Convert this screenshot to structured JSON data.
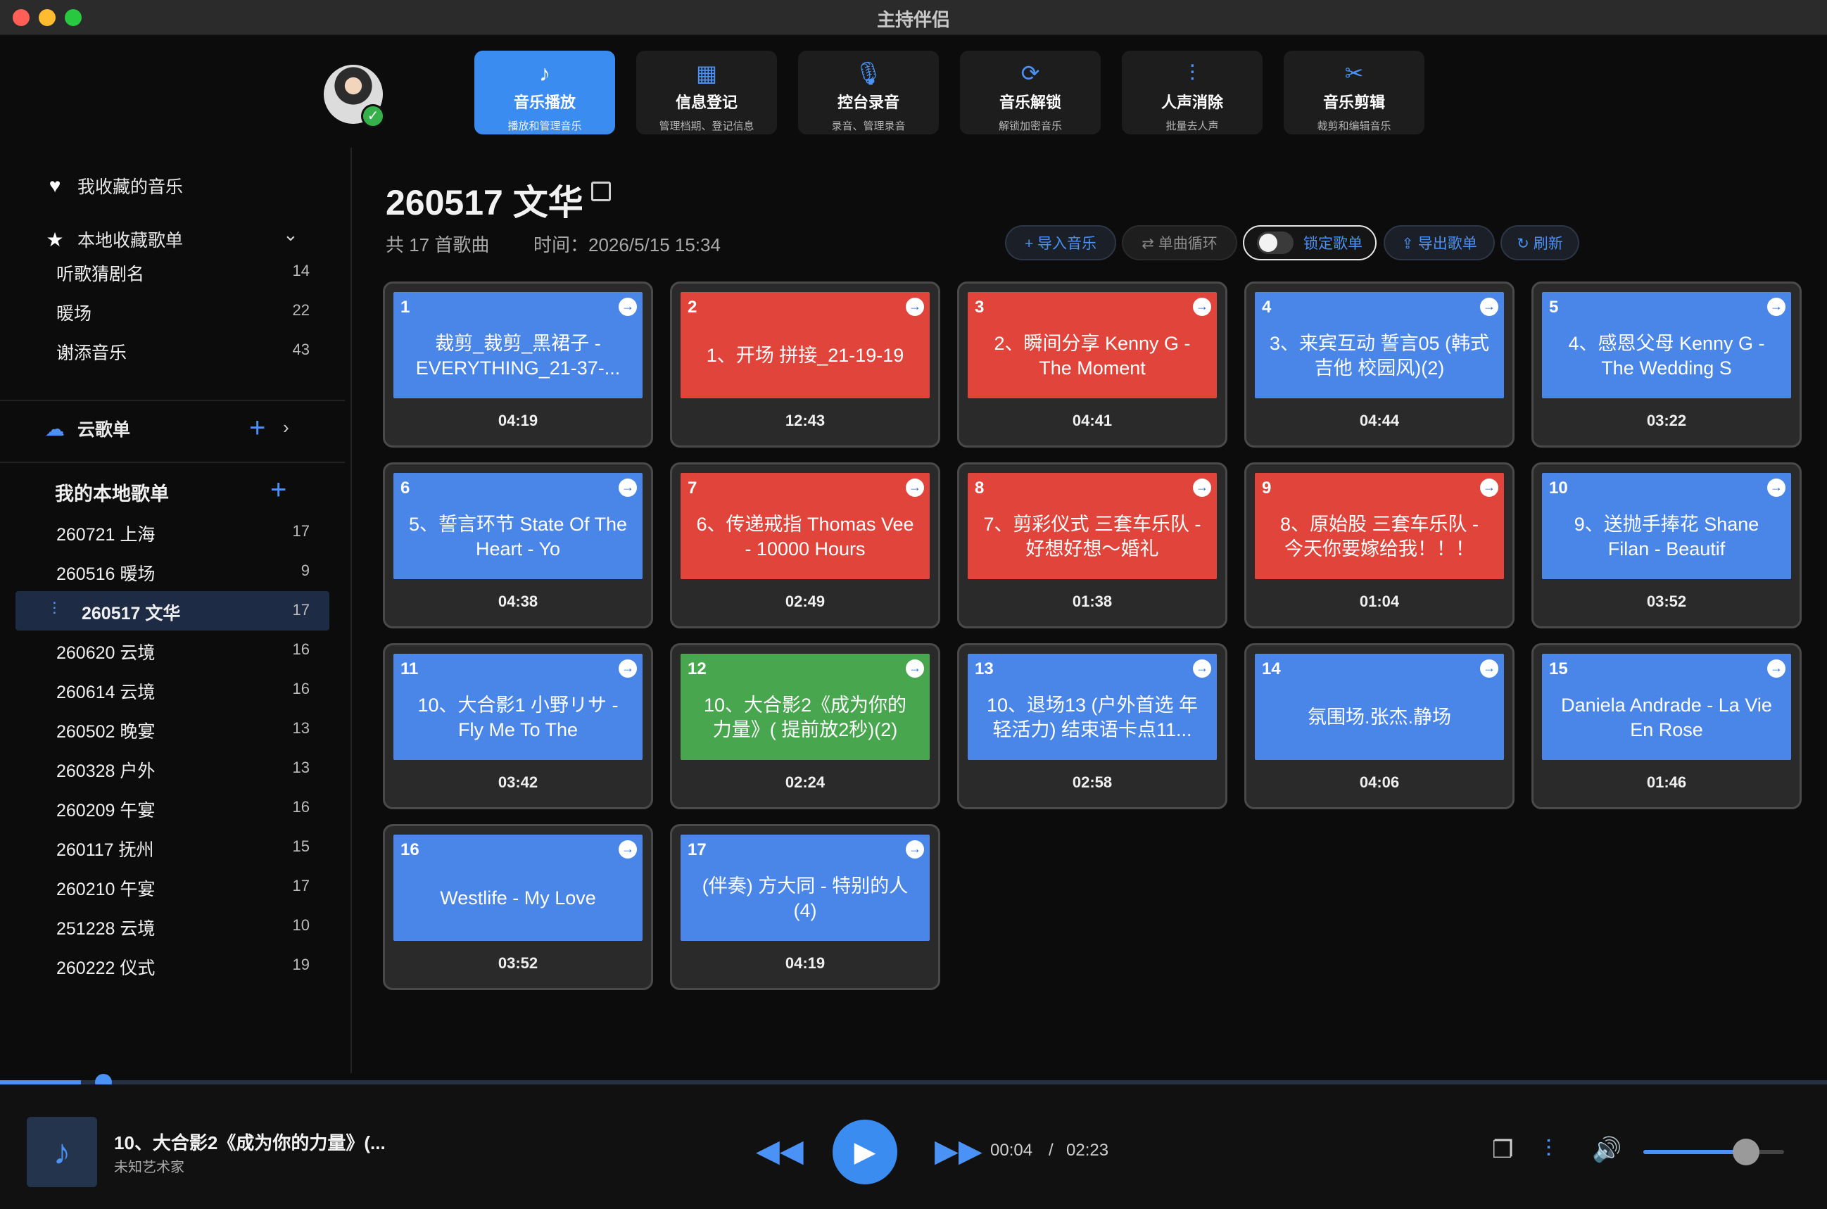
{
  "window": {
    "title": "主持伴侣"
  },
  "nav": {
    "tabs": [
      {
        "label": "音乐播放",
        "sub": "播放和管理音乐",
        "icon": "music-note-icon",
        "glyph": "♪",
        "active": true
      },
      {
        "label": "信息登记",
        "sub": "管理档期、登记信息",
        "icon": "calendar-icon",
        "glyph": "▦",
        "active": false
      },
      {
        "label": "控台录音",
        "sub": "录音、管理录音",
        "icon": "microphone-icon",
        "glyph": "🎙",
        "active": false
      },
      {
        "label": "音乐解锁",
        "sub": "解锁加密音乐",
        "icon": "refresh-icon",
        "glyph": "⟳",
        "active": false
      },
      {
        "label": "人声消除",
        "sub": "批量去人声",
        "icon": "waveform-icon",
        "glyph": "⫶",
        "active": false
      },
      {
        "label": "音乐剪辑",
        "sub": "裁剪和编辑音乐",
        "icon": "scissors-icon",
        "glyph": "✂",
        "active": false
      }
    ]
  },
  "sidebar": {
    "favorites_label": "我收藏的音乐",
    "local_fav_label": "本地收藏歌单",
    "local_fav_items": [
      {
        "name": "听歌猜剧名",
        "count": "14"
      },
      {
        "name": "暖场",
        "count": "22"
      },
      {
        "name": "谢添音乐",
        "count": "43"
      }
    ],
    "cloud_label": "云歌单",
    "my_local_label": "我的本地歌单",
    "my_local_items": [
      {
        "name": "260721 上海",
        "count": "17"
      },
      {
        "name": "260516 暖场",
        "count": "9"
      },
      {
        "name": "260517 文华",
        "count": "17",
        "active": true
      },
      {
        "name": "260620 云境",
        "count": "16"
      },
      {
        "name": "260614 云境",
        "count": "16"
      },
      {
        "name": "260502 晚宴",
        "count": "13"
      },
      {
        "name": "260328 户外",
        "count": "13"
      },
      {
        "name": "260209 午宴",
        "count": "16"
      },
      {
        "name": "260117 抚州",
        "count": "15"
      },
      {
        "name": "260210 午宴",
        "count": "17"
      },
      {
        "name": "251228 云境",
        "count": "10"
      },
      {
        "name": "260222 仪式",
        "count": "19"
      }
    ]
  },
  "playlist": {
    "title": "260517 文华",
    "count_text": "共 17 首歌曲",
    "time_text": "时间：2026/5/15 15:34",
    "actions": {
      "import": "+ 导入音乐",
      "loop": "⇄ 单曲循环",
      "lock": "锁定歌单",
      "export": "⇪ 导出歌单",
      "refresh": "↻ 刷新"
    },
    "songs": [
      {
        "num": "1",
        "name": "裁剪_裁剪_黑裙子 - EVERYTHING_21-37-...",
        "dur": "04:19",
        "color": "blue"
      },
      {
        "num": "2",
        "name": "1、开场 拼接_21-19-19",
        "dur": "12:43",
        "color": "red"
      },
      {
        "num": "3",
        "name": "2、瞬间分享 Kenny G - The Moment",
        "dur": "04:41",
        "color": "red"
      },
      {
        "num": "4",
        "name": "3、来宾互动 誓言05 (韩式 吉他 校园风)(2)",
        "dur": "04:44",
        "color": "blue"
      },
      {
        "num": "5",
        "name": "4、感恩父母 Kenny G - The Wedding S",
        "dur": "03:22",
        "color": "blue"
      },
      {
        "num": "6",
        "name": "5、誓言环节 State Of The Heart - Yo",
        "dur": "04:38",
        "color": "blue"
      },
      {
        "num": "7",
        "name": "6、传递戒指 Thomas Vee - 10000 Hours",
        "dur": "02:49",
        "color": "red"
      },
      {
        "num": "8",
        "name": "7、剪彩仪式 三套车乐队 - 好想好想～婚礼",
        "dur": "01:38",
        "color": "red"
      },
      {
        "num": "9",
        "name": "8、原始股 三套车乐队 - 今天你要嫁给我！！！",
        "dur": "01:04",
        "color": "red"
      },
      {
        "num": "10",
        "name": "9、送抛手捧花 Shane Filan - Beautif",
        "dur": "03:52",
        "color": "blue"
      },
      {
        "num": "11",
        "name": "10、大合影1 小野リサ - Fly Me To The",
        "dur": "03:42",
        "color": "blue"
      },
      {
        "num": "12",
        "name": "10、大合影2《成为你的力量》( 提前放2秒)(2)",
        "dur": "02:24",
        "color": "green"
      },
      {
        "num": "13",
        "name": "10、退场13 (户外首选 年轻活力) 结束语卡点11...",
        "dur": "02:58",
        "color": "blue"
      },
      {
        "num": "14",
        "name": "氛围场.张杰.静场",
        "dur": "04:06",
        "color": "blue"
      },
      {
        "num": "15",
        "name": "Daniela Andrade - La Vie En Rose",
        "dur": "01:46",
        "color": "blue"
      },
      {
        "num": "16",
        "name": "Westlife - My Love",
        "dur": "03:52",
        "color": "blue"
      },
      {
        "num": "17",
        "name": "(伴奏) 方大同 - 特别的人(4)",
        "dur": "04:19",
        "color": "blue"
      }
    ]
  },
  "player": {
    "title": "10、大合影2《成为你的力量》(...",
    "artist": "未知艺术家",
    "current": "00:04",
    "separator": "/",
    "total": "02:23",
    "progress_fraction": 0.029,
    "volume_fraction": 0.68
  },
  "colors": {
    "accent": "#3b8cf1",
    "blue": "#4a86e8",
    "red": "#e0443a",
    "green": "#47a64e"
  }
}
